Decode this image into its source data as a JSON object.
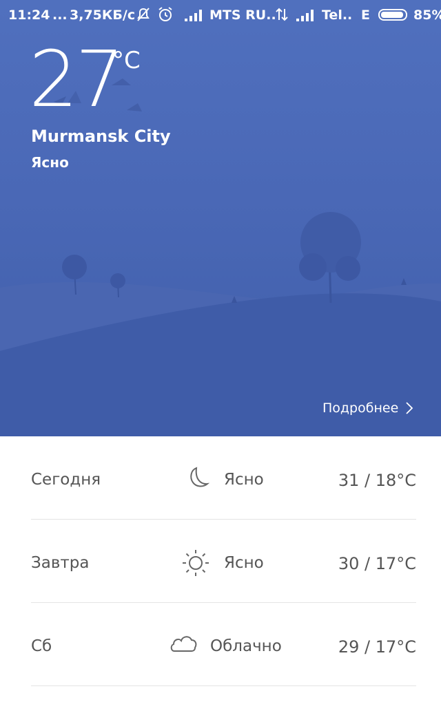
{
  "status_bar": {
    "time": "11:24",
    "dots": "...",
    "speed": "3,75КБ/с",
    "carrier1": "MTS RU..",
    "carrier2": "Tel..",
    "network_type": "E",
    "battery": "85%",
    "icons": [
      "mute-icon",
      "alarm-icon",
      "signal-icon",
      "data-transfer-icon",
      "signal-icon",
      "battery-icon"
    ]
  },
  "current": {
    "temp": "27",
    "unit": "°C",
    "city": "Murmansk City",
    "condition": "Ясно",
    "details_link": "Подробнее"
  },
  "forecast": [
    {
      "day": "Сегодня",
      "icon": "moon-icon",
      "condition": "Ясно",
      "temps": "31 / 18°C"
    },
    {
      "day": "Завтра",
      "icon": "sun-icon",
      "condition": "Ясно",
      "temps": "30 / 17°C"
    },
    {
      "day": "Сб",
      "icon": "cloud-icon",
      "condition": "Облачно",
      "temps": "29 / 17°C"
    }
  ],
  "colors": {
    "hero_top": "#5070be",
    "hero_bottom": "#3f5ea9",
    "text_dark": "#555555",
    "divider": "#e4e4e4"
  }
}
